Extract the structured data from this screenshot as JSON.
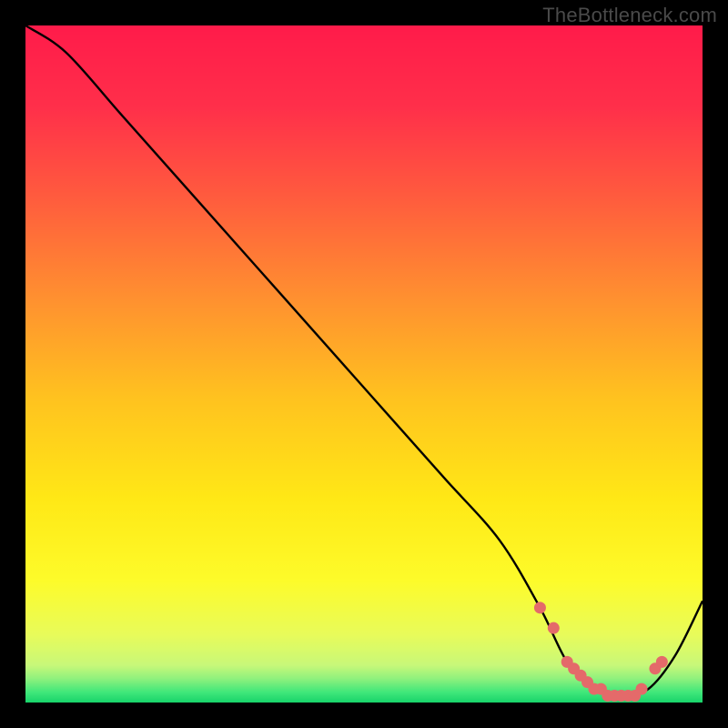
{
  "watermark": "TheBottleneck.com",
  "chart_data": {
    "type": "line",
    "title": "",
    "xlabel": "",
    "ylabel": "",
    "xlim": [
      0,
      100
    ],
    "ylim": [
      0,
      100
    ],
    "series": [
      {
        "name": "bottleneck-curve",
        "x": [
          0,
          6,
          14,
          22,
          30,
          38,
          46,
          54,
          62,
          70,
          76,
          80,
          84,
          88,
          92,
          96,
          100
        ],
        "y": [
          100,
          96,
          87,
          78,
          69,
          60,
          51,
          42,
          33,
          24,
          14,
          6,
          2,
          1,
          2,
          7,
          15
        ]
      }
    ],
    "markers": {
      "name": "highlight-dots",
      "x": [
        76,
        78,
        80,
        81,
        82,
        83,
        84,
        85,
        86,
        87,
        88,
        89,
        90,
        91,
        93,
        94
      ],
      "y": [
        14,
        11,
        6,
        5,
        4,
        3,
        2,
        2,
        1,
        1,
        1,
        1,
        1,
        2,
        5,
        6
      ]
    },
    "gradient_stops": [
      {
        "offset": 0.0,
        "color": "#ff1b4a"
      },
      {
        "offset": 0.12,
        "color": "#ff2f4a"
      },
      {
        "offset": 0.25,
        "color": "#ff5a3e"
      },
      {
        "offset": 0.4,
        "color": "#ff8f30"
      },
      {
        "offset": 0.55,
        "color": "#ffc21f"
      },
      {
        "offset": 0.7,
        "color": "#ffe816"
      },
      {
        "offset": 0.82,
        "color": "#fdfb2a"
      },
      {
        "offset": 0.9,
        "color": "#e8fb5a"
      },
      {
        "offset": 0.945,
        "color": "#c8f879"
      },
      {
        "offset": 0.965,
        "color": "#8ef17d"
      },
      {
        "offset": 0.985,
        "color": "#3fe77a"
      },
      {
        "offset": 1.0,
        "color": "#18d36a"
      }
    ],
    "marker_color": "#e46a6a",
    "curve_color": "#000000"
  }
}
